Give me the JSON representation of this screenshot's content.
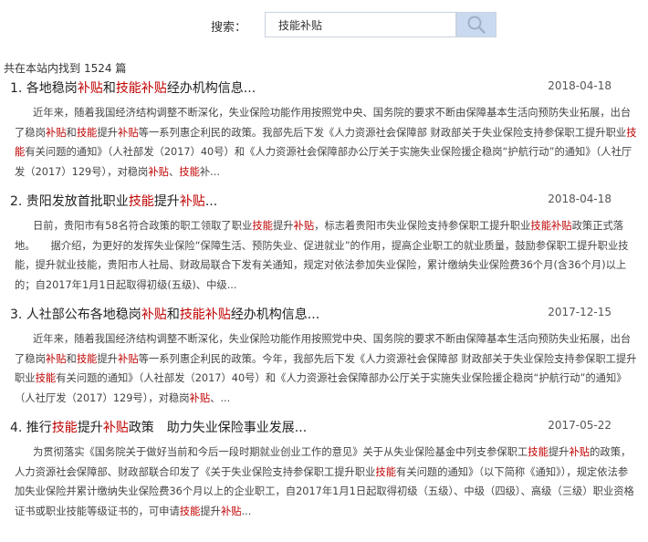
{
  "search": {
    "label": "搜索：",
    "value": "技能补贴",
    "button_icon": "search-icon"
  },
  "summary": {
    "prefix": "共在本站内找到",
    "count": "1524",
    "suffix": "篇"
  },
  "colors": {
    "highlight": "#c00000",
    "search_button": "#c9daf0"
  },
  "results": [
    {
      "title": "1. 各地稳岗[补贴]和[技能补贴]经办机构信息...",
      "date": "2018-04-18",
      "snippet": "近年来，随着我国经济结构调整不断深化，失业保险功能作用按照党中央、国务院的要求不断由保障基本生活向预防失业拓展，出台了稳岗[补贴]和[技能]提升[补贴]等一系列惠企利民的政策。我部先后下发《人力资源社会保障部 财政部关于失业保险支持参保职工提升职业[技能]有关问题的通知》（人社部发（2017）40号）和《人力资源社会保障部办公厅关于实施失业保险援企稳岗“护航行动”的通知》（人社厅发（2017）129号），对稳岗[补贴]、[技能]补..."
    },
    {
      "title": "2. 贵阳发放首批职业[技能]提升[补贴]...",
      "date": "2018-04-18",
      "snippet": "日前，贵阳市有58名符合政策的职工领取了职业[技能]提升[补贴]，标志着贵阳市失业保险支持参保职工提升职业[技能补贴]政策正式落地。　　据介绍，为更好的发挥失业保险“保障生活、预防失业、促进就业”的作用，提高企业职工的就业质量，鼓励参保职工提升职业技能，提升就业技能，贵阳市人社局、财政局联合下发有关通知，规定对依法参加失业保险，累计缴纳失业保险费36个月(含36个月)以上的；自2017年1月1日起取得初级(五级)、中级..."
    },
    {
      "title": "3. 人社部公布各地稳岗[补贴]和[技能补贴]经办机构信息...",
      "date": "2017-12-15",
      "snippet": "近年来，随着我国经济结构调整不断深化，失业保险功能作用按照党中央、国务院的要求不断由保障基本生活向预防失业拓展，出台了稳岗[补贴]和[技能]提升[补贴]等一系列惠企利民的政策。今年，我部先后下发《人力资源社会保障部 财政部关于失业保险支持参保职工提升职业[技能]有关问题的通知》（人社部发（2017）40号）和《人力资源社会保障部办公厅关于实施失业保险援企稳岗“护航行动”的通知》（人社厅发（2017）129号），对稳岗[补贴]、..."
    },
    {
      "title": "4. 推行[技能]提升[补贴]政策　助力失业保险事业发展...",
      "date": "2017-05-22",
      "snippet": "为贯彻落实《国务院关于做好当前和今后一段时期就业创业工作的意见》关于从失业保险基金中列支参保职工[技能]提升[补贴]的政策，人力资源社会保障部、财政部联合印发了《关于失业保险支持参保职工提升职业[技能]有关问题的通知》（以下简称《通知》），规定依法参加失业保险并累计缴纳失业保险费36个月以上的企业职工，自2017年1月1日起取得初级（五级）、中级（四级）、高级（三级）职业资格证书或职业技能等级证书的，可申请[技能]提升[补贴]..."
    }
  ]
}
